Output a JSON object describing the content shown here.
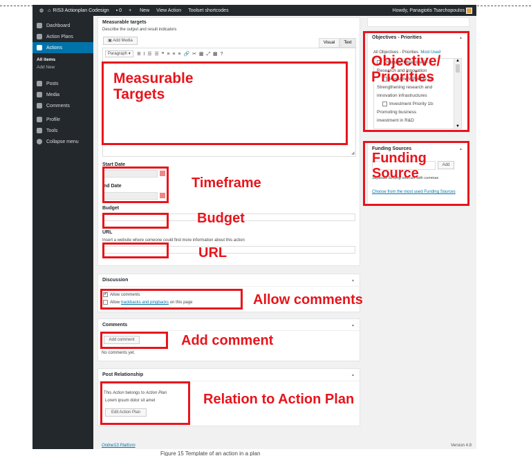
{
  "adminbar": {
    "site": "RIS3 Actionplan Codesign",
    "comments_count": "0",
    "new": "New",
    "view": "View Action",
    "toolset": "Toolset shortcodes",
    "howdy": "Howdy, Panagiotis Tsarchopoulos"
  },
  "sidebar": {
    "dashboard": "Dashboard",
    "action_plans": "Action Plans",
    "actions": "Actions",
    "all_items": "All items",
    "add_new": "Add New",
    "posts": "Posts",
    "media": "Media",
    "comments": "Comments",
    "profile": "Profile",
    "tools": "Tools",
    "collapse": "Collapse menu"
  },
  "measurable": {
    "title": "Measurable targets",
    "desc": "Describe the output and result indicators",
    "add_media": "Add Media",
    "tab_visual": "Visual",
    "tab_text": "Text",
    "paragraph": "Paragraph",
    "toolbar_icons": "B  I  ☰  ☰  ❝  ≡  ≡  ≡  🔗  ✂  ▦  ⤢  ▦  ?"
  },
  "fields": {
    "start_date": "Start Date",
    "end_date": "nd Date",
    "budget": "Budget",
    "url": "URL",
    "url_help": "Insert a website where someone could find more information about this action"
  },
  "discussion": {
    "title": "Discussion",
    "allow_comments": "Allow comments",
    "allow_trackbacks_prefix": "Allow",
    "allow_trackbacks_link": "trackbacks and pingbacks",
    "allow_trackbacks_suffix": "on this page"
  },
  "comments_box": {
    "title": "Comments",
    "add_comment": "Add comment",
    "no_comments": "No comments yet."
  },
  "post_relationship": {
    "title": "Post Relationship",
    "belongs_prefix": "This",
    "belongs_action": "Action",
    "belongs_middle": "belongs to",
    "belongs_plan": "Action Plan",
    "lorem": "Lorem ipsum dolor sit amet",
    "edit_button": "Edit Action Plan"
  },
  "objectives": {
    "title": "Objectives - Priorities",
    "tab_all": "All Objectives - Priorities",
    "tab_most_used": "Most Used",
    "item1": "Thematic Objective 1 -",
    "item1b": "Research and Innovation",
    "item1c": "Investment Priority 1a:",
    "item2": "Strengthening research and",
    "item3": "innovation infrastructures",
    "item4": "Investment Priority 1b:",
    "item5": "Promoting business",
    "item6": "investment in R&D"
  },
  "funding": {
    "title": "Funding Sources",
    "add": "Add",
    "hint": "Separate funding sources with commas",
    "choose": "Choose from the most used Funding Sources"
  },
  "annotations": {
    "measurable": "Measurable Targets",
    "objective": "Objective/ Priorities",
    "funding": "Funding Source",
    "timeframe": "Timeframe",
    "budget": "Budget",
    "url": "URL",
    "allow_comments": "Allow comments",
    "add_comment": "Add comment",
    "relation": "Relation to Action Plan"
  },
  "footer": {
    "left": "OnlineS3 Platform",
    "right": "Version 4.8",
    "caption": "Figure 15 Template of an action in a plan"
  },
  "colors": {
    "annotation_red": "#e8141b",
    "admin_dark": "#23282d",
    "wp_blue": "#0073aa"
  }
}
